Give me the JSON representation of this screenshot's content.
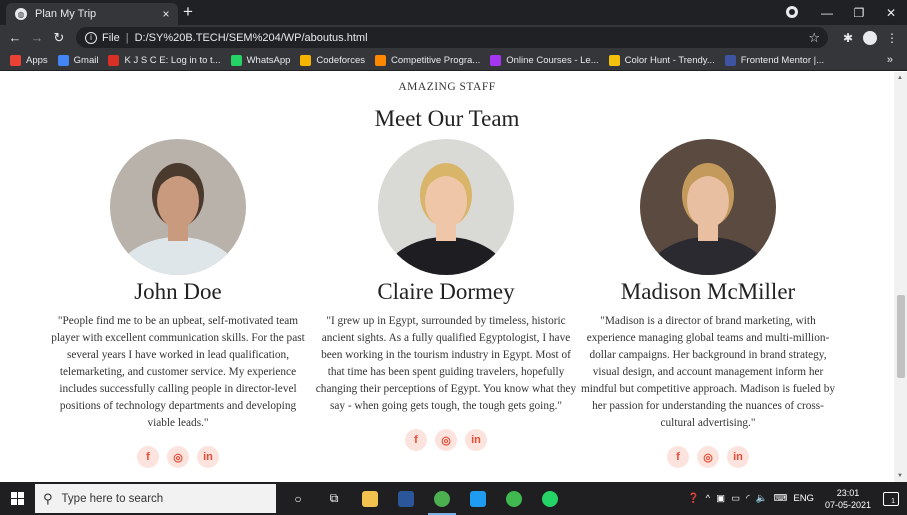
{
  "browser": {
    "tab_title": "Plan My Trip",
    "tab_close": "×",
    "new_tab": "+",
    "address_prefix": "File",
    "address": "D:/SY%20B.TECH/SEM%204/WP/aboutus.html",
    "bookmarks": [
      {
        "label": "Apps",
        "color": "#ea4335"
      },
      {
        "label": "Gmail",
        "color": "#4285f4"
      },
      {
        "label": "K J S C E: Log in to t...",
        "color": "#d93025"
      },
      {
        "label": "WhatsApp",
        "color": "#25d366"
      },
      {
        "label": "Codeforces",
        "color": "#f5b400"
      },
      {
        "label": "Competitive Progra...",
        "color": "#ff8800"
      },
      {
        "label": "Online Courses - Le...",
        "color": "#a435f0"
      },
      {
        "label": "Color Hunt - Trendy...",
        "color": "#f4c20d"
      },
      {
        "label": "Frontend Mentor |...",
        "color": "#3e54a3"
      }
    ],
    "bookmarks_more": "»"
  },
  "page": {
    "kicker": "AMAZING STAFF",
    "heading": "Meet Our Team",
    "members": [
      {
        "name": "John Doe",
        "bio": "\"People find me to be an upbeat, self-motivated team player with excellent communication skills. For the past several years I have worked in lead qualification, telemarketing, and customer service. My experience includes successfully calling people in director-level positions of technology departments and developing viable leads.\"",
        "photo_bg": "#b9b2aa",
        "skin": "#c99a7e",
        "hair": "#4a3a2e",
        "shirt": "#dfe6ea",
        "socials": [
          "f",
          "◎",
          "in"
        ]
      },
      {
        "name": "Claire Dormey",
        "bio": "\"I grew up in Egypt, surrounded by timeless, historic ancient sights. As a fully qualified Egyptologist, I have been working in the tourism industry in Egypt. Most of that time has been spent guiding travelers, hopefully changing their perceptions of Egypt. You know what they say - when going gets tough, the tough gets going.\"",
        "photo_bg": "#d9d9d6",
        "skin": "#efc6a8",
        "hair": "#d9b56a",
        "shirt": "#1d1d22",
        "socials": [
          "f",
          "◎",
          "in"
        ]
      },
      {
        "name": "Madison McMiller",
        "bio": "\"Madison is a director of brand marketing, with experience managing global teams and multi-million-dollar campaigns. Her background in brand strategy, visual design, and account management inform her mindful but competitive approach. Madison is fueled by her passion for understanding the nuances of cross-cultural advertising.\"",
        "photo_bg": "#5a4a3f",
        "skin": "#e8bfa0",
        "hair": "#c49a5c",
        "shirt": "#2a2a30",
        "socials": [
          "f",
          "◎",
          "in"
        ]
      }
    ],
    "accent": "#e94b35"
  },
  "taskbar": {
    "search_placeholder": "Type here to search",
    "tray_lang": "ENG",
    "time": "23:01",
    "date": "07-05-2021",
    "notif_count": "1"
  }
}
